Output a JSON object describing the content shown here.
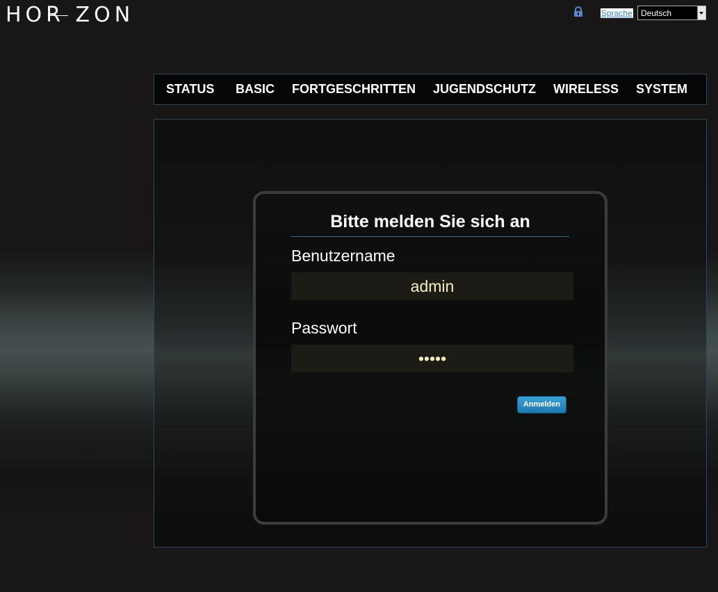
{
  "header": {
    "logo_text": "HOR ZON",
    "language_link": "Sprache",
    "language_selected": "Deutsch"
  },
  "nav": {
    "items": [
      {
        "label": "STATUS"
      },
      {
        "label": "BASIC"
      },
      {
        "label": "FORTGESCHRITTEN"
      },
      {
        "label": "JUGENDSCHUTZ"
      },
      {
        "label": "WIRELESS"
      },
      {
        "label": "SYSTEM"
      }
    ]
  },
  "login": {
    "title": "Bitte melden Sie sich an",
    "username_label": "Benutzername",
    "username_value": "admin",
    "password_label": "Passwort",
    "password_value": "•••••",
    "submit_label": "Anmelden"
  },
  "colors": {
    "accent": "#2a8cc4",
    "input_text": "#f6efc0",
    "border": "#2f4a57"
  }
}
